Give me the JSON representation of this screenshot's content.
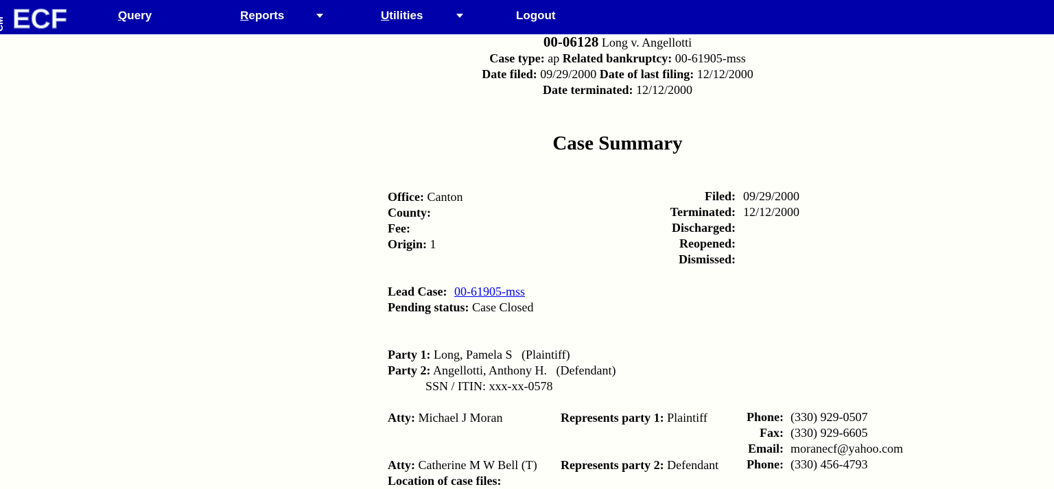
{
  "nav": {
    "logo_cm": "CM",
    "logo_ecf": "ECF",
    "query": {
      "accel": "Q",
      "rest": "uery"
    },
    "reports": {
      "accel": "R",
      "rest": "eports"
    },
    "utilities": {
      "accel": "U",
      "rest": "tilities"
    },
    "logout": "Logout"
  },
  "header": {
    "case_number": "00-06128",
    "case_title": "Long v. Angellotti",
    "case_type_label": "Case type:",
    "case_type_value": "ap",
    "related_label": "Related bankruptcy:",
    "related_value": "00-61905-mss",
    "date_filed_label": "Date filed:",
    "date_filed_value": "09/29/2000",
    "last_filing_label": "Date of last filing:",
    "last_filing_value": "12/12/2000",
    "terminated_label": "Date terminated:",
    "terminated_value": "12/12/2000"
  },
  "title": "Case Summary",
  "summary": {
    "office_label": "Office:",
    "office_value": "Canton",
    "county_label": "County:",
    "fee_label": "Fee:",
    "origin_label": "Origin:",
    "origin_value": "1",
    "filed_label": "Filed:",
    "filed_value": "09/29/2000",
    "terminated_label": "Terminated:",
    "terminated_value": "12/12/2000",
    "discharged_label": "Discharged:",
    "reopened_label": "Reopened:",
    "dismissed_label": "Dismissed:"
  },
  "lead": {
    "lead_label": "Lead Case:",
    "lead_value": "00-61905-mss",
    "pending_label": "Pending status:",
    "pending_value": "Case Closed"
  },
  "parties": {
    "p1_label": "Party 1:",
    "p1_value": "Long, Pamela S   (Plaintiff)",
    "p2_label": "Party 2:",
    "p2_value": "Angellotti, Anthony H.   (Defendant)",
    "p2_ssn": "SSN / ITIN: xxx-xx-0578"
  },
  "attorneys": {
    "atty_label": "Atty:",
    "a1_name": "Michael J Moran",
    "a1_rep_label": "Represents party 1:",
    "a1_rep_value": "Plaintiff",
    "phone_label": "Phone:",
    "a1_phone": "(330) 929-0507",
    "fax_label": "Fax:",
    "a1_fax": "(330) 929-6605",
    "email_label": "Email:",
    "a1_email": "moranecf@yahoo.com",
    "a2_name": "Catherine M W Bell (T)",
    "a2_rep_label": "Represents party 2:",
    "a2_rep_value": "Defendant",
    "a2_phone": "(330) 456-4793",
    "location_label": "Location of case files:"
  },
  "colors": {
    "nav_bg": "#0000aa",
    "page_bg": "#fffffa",
    "link": "#0000ee"
  }
}
